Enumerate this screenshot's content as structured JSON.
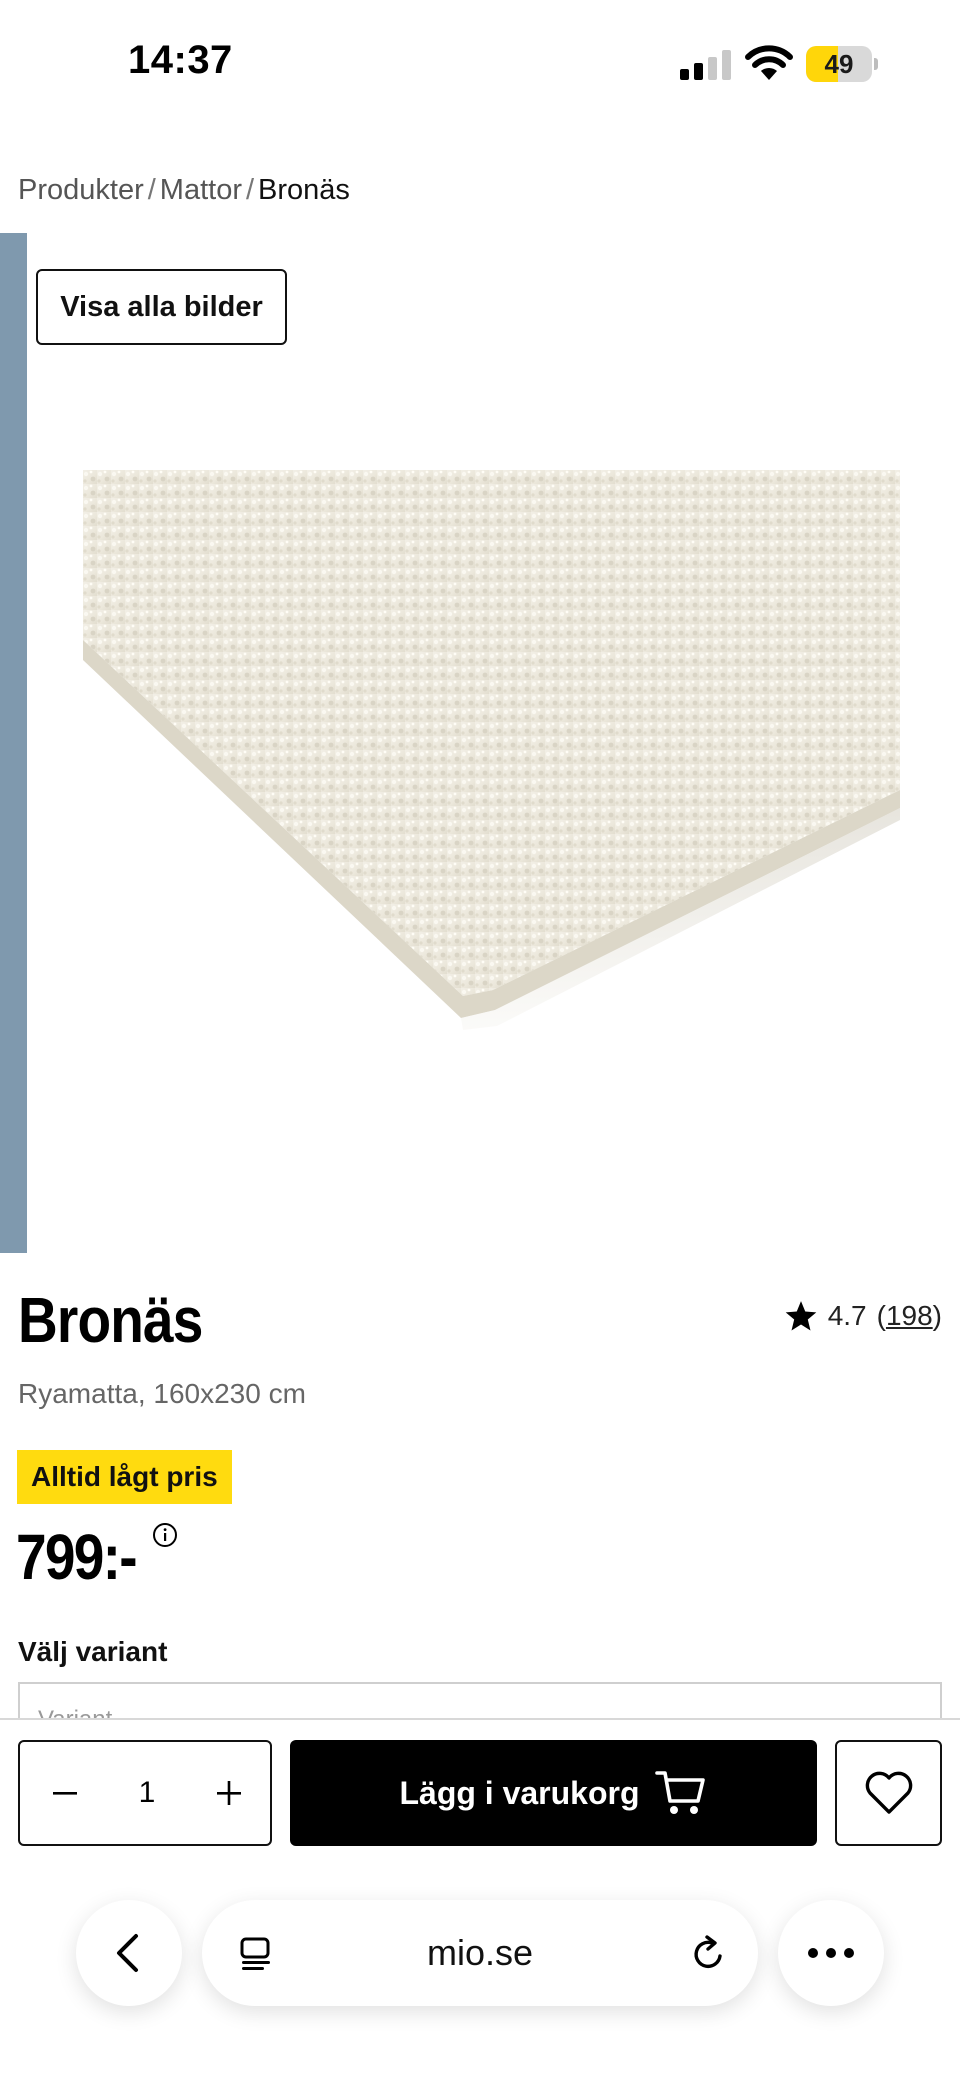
{
  "status_bar": {
    "time": "14:37",
    "battery_level": "49",
    "battery_fraction": 0.49
  },
  "breadcrumb": {
    "items": [
      "Produkter",
      "Mattor"
    ],
    "separator": "/",
    "current": "Bronäs"
  },
  "gallery": {
    "show_all_label": "Visa alla bilder"
  },
  "product": {
    "title": "Bronäs",
    "subtitle": "Ryamatta, 160x230 cm",
    "rating": "4.7",
    "review_count": "198",
    "badge": "Alltid lågt pris",
    "price": "799:-",
    "variant_label": "Välj variant",
    "variant_placeholder": "Variant"
  },
  "actions": {
    "quantity": "1",
    "add_to_cart_label": "Lägg i varukorg"
  },
  "browser": {
    "url": "mio.se"
  },
  "colors": {
    "badge": "#ffdb0f",
    "cart_button": "#000000",
    "gallery_scroll": "#7f99ae",
    "battery": "#ffd60a"
  },
  "icons": [
    "signal-icon",
    "wifi-icon",
    "battery-icon",
    "star-icon",
    "info-icon",
    "minus-icon",
    "plus-icon",
    "cart-icon",
    "heart-icon",
    "back-icon",
    "tabs-icon",
    "reload-icon",
    "more-icon"
  ]
}
